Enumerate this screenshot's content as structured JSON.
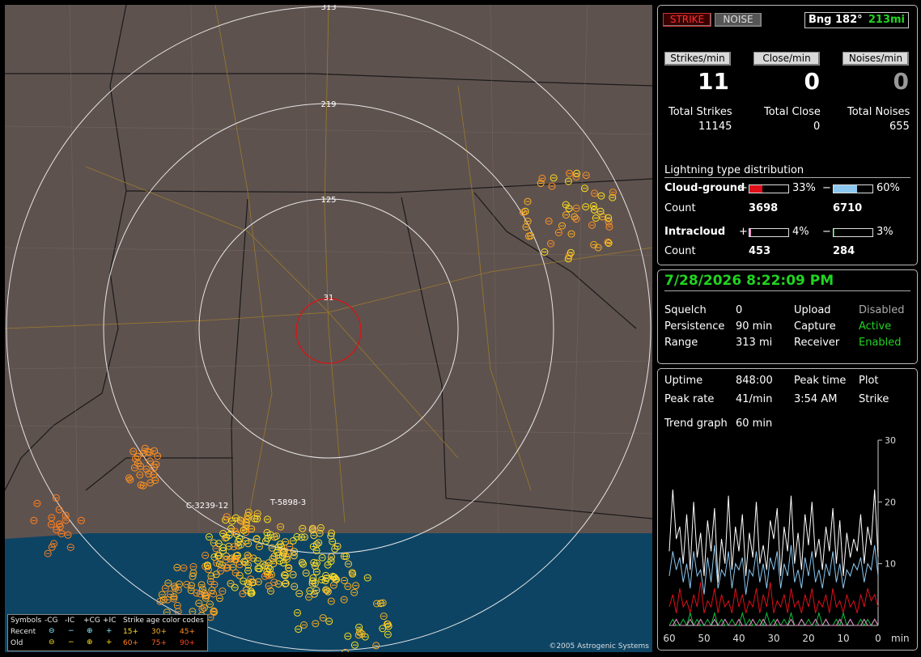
{
  "header": {
    "strike_label": "STRIKE",
    "noise_label": "NOISE",
    "bearing": "Bng 182°",
    "distance": "213mi"
  },
  "rates": {
    "strikes_label": "Strikes/min",
    "close_label": "Close/min",
    "noises_label": "Noises/min",
    "strikes_value": "11",
    "close_value": "0",
    "noises_value": "0"
  },
  "totals": {
    "strikes_label": "Total Strikes",
    "close_label": "Total Close",
    "noises_label": "Total Noises",
    "strikes_value": "11145",
    "close_value": "0",
    "noises_value": "655"
  },
  "distribution": {
    "title": "Lightning type distribution",
    "cg_label": "Cloud-ground",
    "ic_label": "Intracloud",
    "count_label": "Count",
    "plus": "+",
    "minus": "−",
    "cg_pos_pct": "33%",
    "cg_neg_pct": "60%",
    "cg_pos_count": "3698",
    "cg_neg_count": "6710",
    "ic_pos_pct": "4%",
    "ic_neg_pct": "3%",
    "ic_pos_count": "453",
    "ic_neg_count": "284",
    "cg_pos_frac": 0.33,
    "cg_neg_frac": 0.6,
    "ic_pos_frac": 0.04,
    "ic_neg_frac": 0.03,
    "colors": {
      "cg_pos": "#e0101a",
      "cg_neg": "#8cc8f0",
      "ic_pos": "#f090d0",
      "ic_neg": "#10a040"
    }
  },
  "status": {
    "datetime": "7/28/2026 8:22:09 PM",
    "squelch_label": "Squelch",
    "squelch_value": "0",
    "persistence_label": "Persistence",
    "persistence_value": "90 min",
    "range_label": "Range",
    "range_value": "313 mi",
    "upload_label": "Upload",
    "upload_value": "Disabled",
    "capture_label": "Capture",
    "capture_value": "Active",
    "receiver_label": "Receiver",
    "receiver_value": "Enabled"
  },
  "stats": {
    "uptime_label": "Uptime",
    "uptime_value": "848:00",
    "peak_time_label": "Peak time",
    "peak_time_value": "3:54 AM",
    "plot_label": "Plot",
    "plot_value": "Strike",
    "peak_rate_label": "Peak rate",
    "peak_rate_value": "41/min",
    "trend_label": "Trend graph",
    "trend_value": "60 min"
  },
  "map": {
    "ring_labels": [
      "313",
      "219",
      "125",
      "31"
    ],
    "annotations": [
      "C-3239-12",
      "T-5898-3"
    ],
    "copyright": "©2005 Astrogenic Systems",
    "legend": {
      "symbols": "Symbols",
      "cols": [
        "-CG",
        "-IC",
        "+CG",
        "+IC"
      ],
      "age_title": "Strike age color codes",
      "recent": "Recent",
      "old": "Old",
      "ages_recent": [
        "15+",
        "30+",
        "45+"
      ],
      "ages_old": [
        "60+",
        "75+",
        "90+"
      ]
    }
  },
  "chart_data": {
    "type": "line",
    "xlabel": "min",
    "x_ticks": [
      "60",
      "50",
      "40",
      "30",
      "20",
      "10",
      "0"
    ],
    "y_ticks": [
      "30",
      "20",
      "10"
    ],
    "ylim": [
      0,
      30
    ],
    "xlim": [
      60,
      0
    ],
    "series": [
      {
        "color": "#ffffff",
        "values": [
          12,
          22,
          14,
          16,
          10,
          18,
          9,
          20,
          11,
          15,
          8,
          17,
          12,
          19,
          7,
          14,
          10,
          21,
          9,
          16,
          12,
          18,
          8,
          15,
          11,
          20,
          10,
          13,
          9,
          17,
          14,
          19,
          8,
          16,
          12,
          21,
          10,
          15,
          9,
          18,
          13,
          20,
          11,
          14,
          9,
          16,
          12,
          19,
          10,
          17,
          8,
          15,
          11,
          14,
          12,
          18,
          10,
          16,
          13,
          22,
          11
        ]
      },
      {
        "color": "#8cc8f0",
        "values": [
          8,
          12,
          9,
          11,
          7,
          10,
          6,
          12,
          8,
          9,
          5,
          11,
          7,
          13,
          6,
          9,
          8,
          12,
          6,
          10,
          9,
          11,
          5,
          9,
          8,
          12,
          7,
          10,
          6,
          11,
          9,
          12,
          6,
          10,
          8,
          13,
          7,
          9,
          6,
          11,
          8,
          12,
          7,
          9,
          6,
          10,
          8,
          12,
          7,
          10,
          6,
          9,
          8,
          10,
          9,
          11,
          7,
          10,
          9,
          13,
          8
        ]
      },
      {
        "color": "#e0101a",
        "values": [
          3,
          5,
          2,
          6,
          3,
          4,
          2,
          5,
          3,
          7,
          2,
          4,
          3,
          6,
          2,
          5,
          3,
          4,
          2,
          6,
          3,
          5,
          2,
          4,
          3,
          6,
          2,
          5,
          3,
          7,
          2,
          4,
          3,
          5,
          2,
          6,
          3,
          4,
          2,
          5,
          3,
          6,
          2,
          4,
          3,
          5,
          2,
          6,
          3,
          4,
          2,
          5,
          3,
          4,
          2,
          5,
          3,
          6,
          4,
          5,
          3
        ]
      },
      {
        "color": "#10c040",
        "values": [
          0,
          1,
          0,
          0,
          1,
          0,
          2,
          0,
          1,
          0,
          0,
          1,
          0,
          2,
          0,
          1,
          0,
          0,
          1,
          0,
          0,
          2,
          0,
          1,
          0,
          0,
          1,
          0,
          2,
          0,
          1,
          0,
          0,
          1,
          0,
          2,
          0,
          0,
          1,
          0,
          1,
          0,
          0,
          2,
          0,
          1,
          0,
          0,
          1,
          0,
          2,
          0,
          1,
          0,
          0,
          1,
          0,
          1,
          0,
          1,
          0
        ]
      },
      {
        "color": "#f090d0",
        "values": [
          0,
          0,
          1,
          0,
          0,
          0,
          1,
          0,
          0,
          1,
          0,
          0,
          0,
          1,
          0,
          0,
          1,
          0,
          0,
          0,
          1,
          0,
          0,
          0,
          1,
          0,
          0,
          1,
          0,
          0,
          0,
          1,
          0,
          0,
          0,
          1,
          0,
          0,
          1,
          0,
          0,
          0,
          1,
          0,
          0,
          1,
          0,
          0,
          0,
          1,
          0,
          0,
          1,
          0,
          0,
          0,
          1,
          0,
          0,
          1,
          0
        ]
      }
    ]
  }
}
